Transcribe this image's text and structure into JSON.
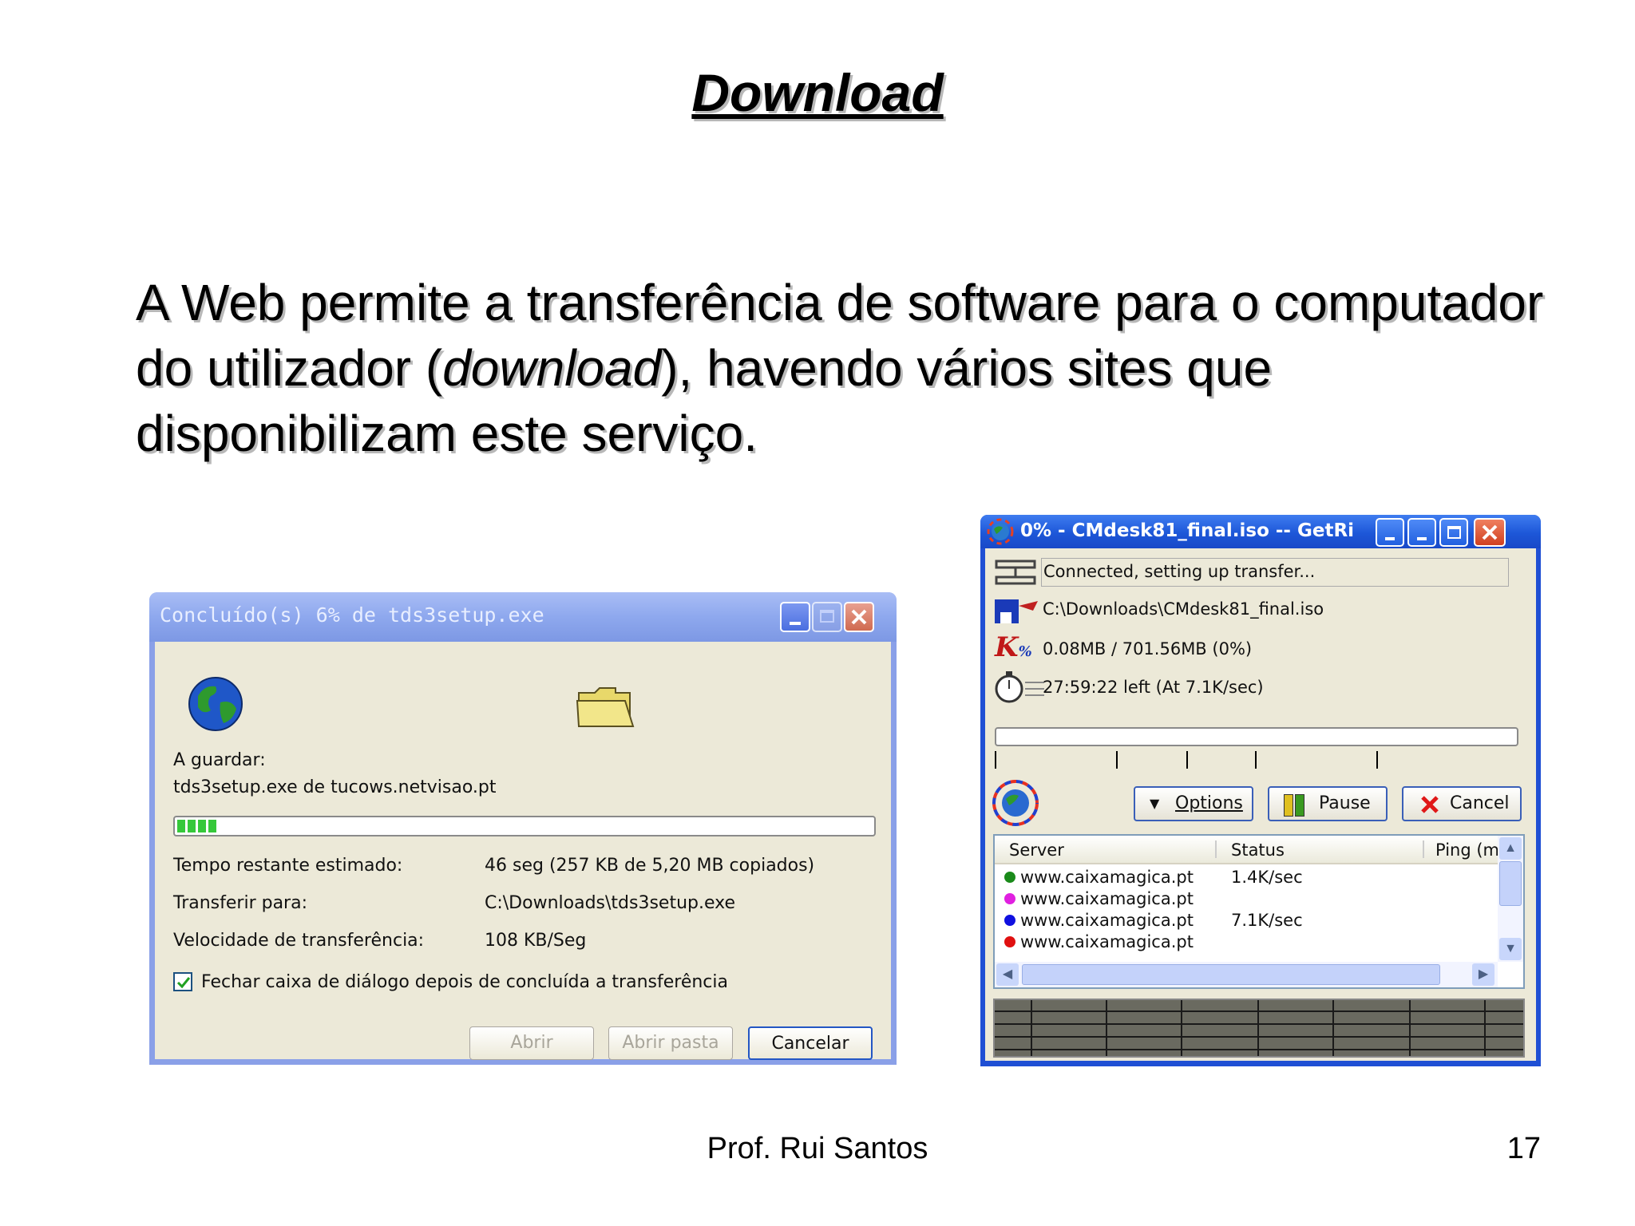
{
  "slide": {
    "title": "Download ",
    "body_part1": "A Web permite a transferência de software para o computador do utilizador (",
    "body_italic": "download",
    "body_part2": "), havendo vários sites que disponibilizam este serviço.",
    "footer_author": "Prof. Rui Santos",
    "footer_page": "17"
  },
  "dialog1": {
    "title": "Concluído(s) 6% de tds3setup.exe",
    "saving_label": "A guardar:",
    "saving_value": "tds3setup.exe de tucows.netvisao.pt",
    "progress_fraction": 0.06,
    "rows": [
      {
        "label": "Tempo restante estimado:",
        "value": "46 seg (257 KB de 5,20 MB copiados)"
      },
      {
        "label": "Transferir para:",
        "value": "C:\\Downloads\\tds3setup.exe"
      },
      {
        "label": "Velocidade de transferência:",
        "value": "108 KB/Seg"
      }
    ],
    "checkbox_label": "Fechar caixa de diálogo depois de concluída a transferência",
    "checkbox_checked": true,
    "buttons": {
      "open": "Abrir",
      "open_folder": "Abrir pasta",
      "cancel": "Cancelar"
    }
  },
  "getright": {
    "title": "0% - CMdesk81_final.iso -- GetRi",
    "status": "Connected, setting up transfer...",
    "path": "C:\\Downloads\\CMdesk81_final.iso",
    "size": "0.08MB / 701.56MB (0%)",
    "time": "27:59:22 left  (At 7.1K/sec)",
    "progress_fraction": 0.0,
    "buttons": {
      "options": "Options",
      "pause": "Pause",
      "cancel": "Cancel"
    },
    "columns": [
      "Server",
      "Status",
      "Ping (m"
    ],
    "servers": [
      {
        "name": "www.caixamagica.pt",
        "status": "1.4K/sec",
        "color": "#1a8a1a"
      },
      {
        "name": "www.caixamagica.pt",
        "status": "",
        "color": "#e020e0"
      },
      {
        "name": "www.caixamagica.pt",
        "status": "7.1K/sec",
        "color": "#1010e0"
      },
      {
        "name": "www.caixamagica.pt",
        "status": "",
        "color": "#e01010"
      }
    ]
  }
}
